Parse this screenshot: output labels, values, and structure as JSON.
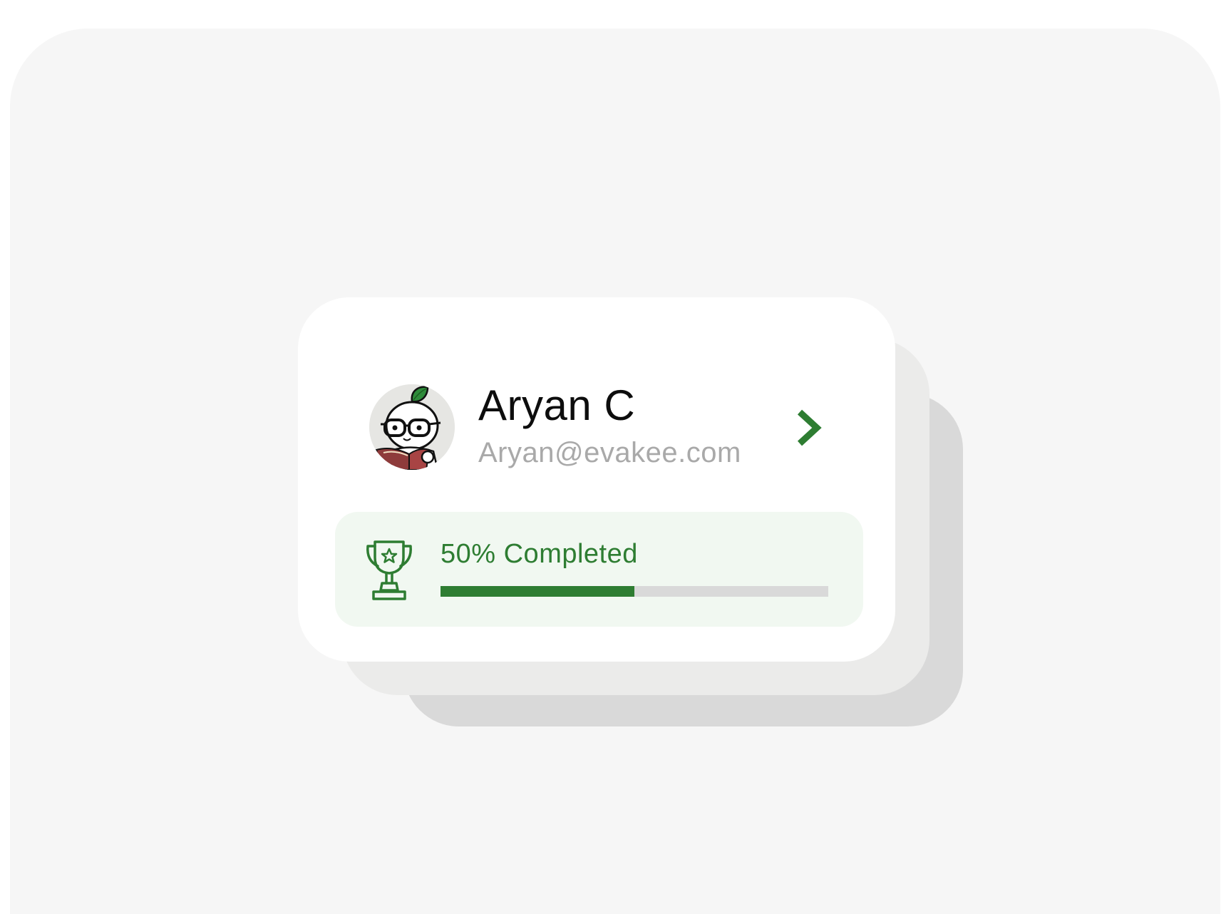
{
  "profile": {
    "name": "Aryan C",
    "email": "Aryan@evakee.com",
    "avatar_icon": "mascot-avatar-icon",
    "open_icon": "chevron-right-icon"
  },
  "progress": {
    "label": "50% Completed",
    "fraction": 0.5,
    "icon": "trophy-icon"
  },
  "colors": {
    "accent": "#2e7d32",
    "name_text": "#0d0d0d",
    "email_text": "#a9a9a9",
    "progress_bg": "#f1f8f1",
    "track": "#d9d9d9",
    "panel_bg": "#f6f6f6"
  }
}
